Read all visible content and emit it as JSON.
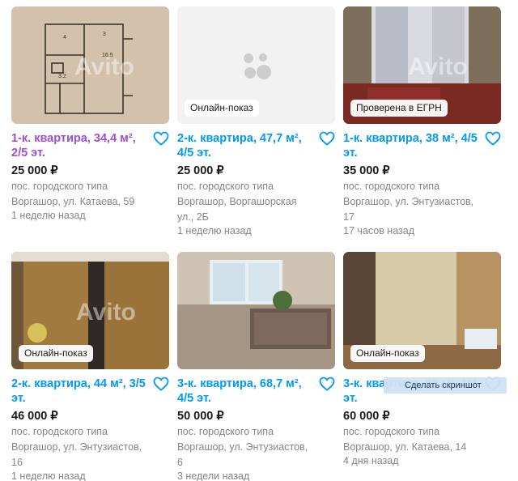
{
  "listings": [
    {
      "title": "1-к. квартира, 34,4 м², 2/5 эт.",
      "price": "25 000 ₽",
      "addr1": "пос. городского типа",
      "addr2": "Воргашор, ул. Катаева, 59",
      "addr3": "",
      "date": "1 неделю назад",
      "badge": "",
      "watermark": "Avito"
    },
    {
      "title": "2-к. квартира, 47,7 м², 4/5 эт.",
      "price": "25 000 ₽",
      "addr1": "пос. городского типа",
      "addr2": "Воргашор, Воргашорская",
      "addr3": "ул., 2Б",
      "date": "1 неделю назад",
      "badge": "Онлайн-показ",
      "watermark": ""
    },
    {
      "title": "1-к. квартира, 38 м², 4/5 эт.",
      "price": "35 000 ₽",
      "addr1": "пос. городского типа",
      "addr2": "Воргашор, ул. Энтузиастов,",
      "addr3": "17",
      "date": "17 часов назад",
      "badge": "Проверена в ЕГРН",
      "watermark": "Avito"
    },
    {
      "title": "2-к. квартира, 44 м², 3/5 эт.",
      "price": "46 000 ₽",
      "addr1": "пос. городского типа",
      "addr2": "Воргашор, ул. Энтузиастов,",
      "addr3": "16",
      "date": "1 неделю назад",
      "badge": "Онлайн-показ",
      "watermark": "Avito"
    },
    {
      "title": "3-к. квартира, 68,7 м², 4/5 эт.",
      "price": "50 000 ₽",
      "addr1": "пос. городского типа",
      "addr2": "Воргашор, ул. Энтузиастов,",
      "addr3": "6",
      "date": "3 недели назад",
      "badge": "",
      "watermark": ""
    },
    {
      "title": "3-к. квартира, 65 м², 1/4 эт.",
      "price": "60 000 ₽",
      "addr1": "пос. городского типа",
      "addr2": "Воргашор, ул. Катаева, 14",
      "addr3": "",
      "date": "4 дня назад",
      "badge": "Онлайн-показ",
      "watermark": ""
    }
  ],
  "tooltip": "Сделать скриншот",
  "colors": {
    "link": "#0099f7",
    "visited": "#9e4ed8",
    "muted": "#858585"
  }
}
